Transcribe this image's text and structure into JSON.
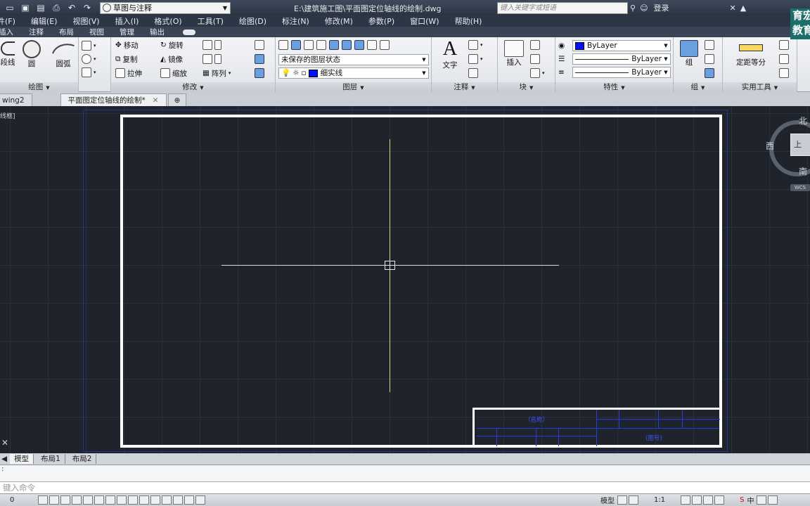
{
  "titlebar": {
    "workspace": "草图与注释",
    "document": "E:\\建筑施工图\\平面图定位轴线的绘制.dwg",
    "search_placeholder": "键入关键字或短语",
    "login": "登录"
  },
  "menus": [
    "件(F)",
    "编辑(E)",
    "视图(V)",
    "插入(I)",
    "格式(O)",
    "工具(T)",
    "绘图(D)",
    "标注(N)",
    "修改(M)",
    "参数(P)",
    "窗口(W)",
    "帮助(H)"
  ],
  "ribbon_tabs": [
    "插入",
    "注释",
    "布局",
    "视图",
    "管理",
    "输出"
  ],
  "ribbon": {
    "draw": {
      "title": "绘图",
      "polyline": "段线",
      "circle": "圆",
      "arc": "圆弧"
    },
    "modify": {
      "title": "修改",
      "move": "移动",
      "rotate": "旋转",
      "copy": "复制",
      "mirror": "镜像",
      "stretch": "拉伸",
      "scale": "缩放",
      "array": "阵列"
    },
    "layers": {
      "title": "图层",
      "state": "未保存的图层状态",
      "current_layer": "细实线"
    },
    "annotation": {
      "title": "注释",
      "text": "文字"
    },
    "block": {
      "title": "块",
      "insert": "插入"
    },
    "properties": {
      "title": "特性",
      "color": "ByLayer",
      "linetype": "ByLayer",
      "lineweight": "ByLayer"
    },
    "groups": {
      "title": "组",
      "group": "组"
    },
    "utilities": {
      "title": "实用工具",
      "measure": "定距等分"
    }
  },
  "file_tabs": [
    {
      "label": "wing2",
      "active": false
    },
    {
      "label": "平面图定位轴线的绘制*",
      "active": true
    }
  ],
  "viewport_label": "线框]",
  "titleblock": {
    "name_cell": "（名称）",
    "code_cell": "(图号)"
  },
  "viewcube": {
    "north": "北",
    "west": "西",
    "south": "南",
    "face": "上",
    "wcs": "WCS"
  },
  "brand": {
    "line1": "育宏",
    "line2": "教育"
  },
  "layout_tabs": [
    "模型",
    "布局1",
    "布局2"
  ],
  "command": {
    "placeholder": "键入命令"
  },
  "status": {
    "coords": "0",
    "model": "模型",
    "scale": "1:1",
    "ime": "中"
  }
}
